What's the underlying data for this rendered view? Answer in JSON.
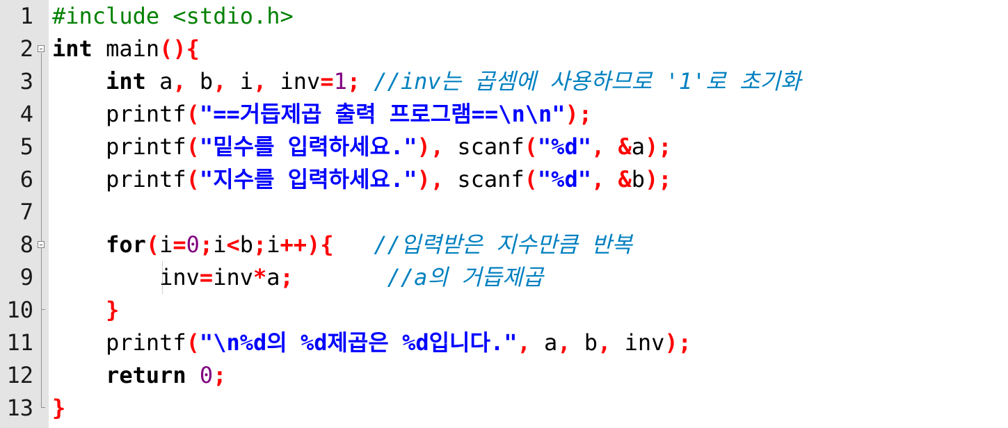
{
  "editor": {
    "line_numbers": [
      "1",
      "2",
      "3",
      "4",
      "5",
      "6",
      "7",
      "8",
      "9",
      "10",
      "11",
      "12",
      "13"
    ],
    "lines": [
      [
        {
          "t": "#include <stdio.h>",
          "c": "pp"
        }
      ],
      [
        {
          "t": "int",
          "c": "kw"
        },
        {
          "t": " main",
          "c": "id"
        },
        {
          "t": "(){",
          "c": "op"
        }
      ],
      [
        {
          "t": "    ",
          "c": "id"
        },
        {
          "t": "int",
          "c": "kw"
        },
        {
          "t": " a",
          "c": "id"
        },
        {
          "t": ",",
          "c": "op"
        },
        {
          "t": " b",
          "c": "id"
        },
        {
          "t": ",",
          "c": "op"
        },
        {
          "t": " i",
          "c": "id"
        },
        {
          "t": ",",
          "c": "op"
        },
        {
          "t": " inv",
          "c": "id"
        },
        {
          "t": "=",
          "c": "op"
        },
        {
          "t": "1",
          "c": "num"
        },
        {
          "t": ";",
          "c": "op"
        },
        {
          "t": " //inv는 곱셈에 사용하므로 '1'로 초기화",
          "c": "cm"
        }
      ],
      [
        {
          "t": "    printf",
          "c": "id"
        },
        {
          "t": "(",
          "c": "op"
        },
        {
          "t": "\"==거듭제곱 출력 프로그램==\\n\\n\"",
          "c": "str"
        },
        {
          "t": ");",
          "c": "op"
        }
      ],
      [
        {
          "t": "    printf",
          "c": "id"
        },
        {
          "t": "(",
          "c": "op"
        },
        {
          "t": "\"밑수를 입력하세요.\"",
          "c": "str"
        },
        {
          "t": "),",
          "c": "op"
        },
        {
          "t": " scanf",
          "c": "id"
        },
        {
          "t": "(",
          "c": "op"
        },
        {
          "t": "\"%d\"",
          "c": "str"
        },
        {
          "t": ",",
          "c": "op"
        },
        {
          "t": " ",
          "c": "id"
        },
        {
          "t": "&",
          "c": "op"
        },
        {
          "t": "a",
          "c": "id"
        },
        {
          "t": ");",
          "c": "op"
        }
      ],
      [
        {
          "t": "    printf",
          "c": "id"
        },
        {
          "t": "(",
          "c": "op"
        },
        {
          "t": "\"지수를 입력하세요.\"",
          "c": "str"
        },
        {
          "t": "),",
          "c": "op"
        },
        {
          "t": " scanf",
          "c": "id"
        },
        {
          "t": "(",
          "c": "op"
        },
        {
          "t": "\"%d\"",
          "c": "str"
        },
        {
          "t": ",",
          "c": "op"
        },
        {
          "t": " ",
          "c": "id"
        },
        {
          "t": "&",
          "c": "op"
        },
        {
          "t": "b",
          "c": "id"
        },
        {
          "t": ");",
          "c": "op"
        }
      ],
      [
        {
          "t": "",
          "c": "id"
        }
      ],
      [
        {
          "t": "    ",
          "c": "id"
        },
        {
          "t": "for",
          "c": "kw"
        },
        {
          "t": "(",
          "c": "op"
        },
        {
          "t": "i",
          "c": "id"
        },
        {
          "t": "=",
          "c": "op"
        },
        {
          "t": "0",
          "c": "num"
        },
        {
          "t": ";",
          "c": "op"
        },
        {
          "t": "i",
          "c": "id"
        },
        {
          "t": "<",
          "c": "op"
        },
        {
          "t": "b",
          "c": "id"
        },
        {
          "t": ";",
          "c": "op"
        },
        {
          "t": "i",
          "c": "id"
        },
        {
          "t": "++){",
          "c": "op"
        },
        {
          "t": "   //입력받은 지수만큼 반복",
          "c": "cm"
        }
      ],
      [
        {
          "t": "        inv",
          "c": "id"
        },
        {
          "t": "=",
          "c": "op"
        },
        {
          "t": "inv",
          "c": "id"
        },
        {
          "t": "*",
          "c": "op"
        },
        {
          "t": "a",
          "c": "id"
        },
        {
          "t": ";",
          "c": "op"
        },
        {
          "t": "       //a의 거듭제곱",
          "c": "cm"
        }
      ],
      [
        {
          "t": "    ",
          "c": "id"
        },
        {
          "t": "}",
          "c": "op"
        }
      ],
      [
        {
          "t": "    printf",
          "c": "id"
        },
        {
          "t": "(",
          "c": "op"
        },
        {
          "t": "\"\\n%d의 %d제곱은 %d입니다.\"",
          "c": "str"
        },
        {
          "t": ",",
          "c": "op"
        },
        {
          "t": " a",
          "c": "id"
        },
        {
          "t": ",",
          "c": "op"
        },
        {
          "t": " b",
          "c": "id"
        },
        {
          "t": ",",
          "c": "op"
        },
        {
          "t": " inv",
          "c": "id"
        },
        {
          "t": ");",
          "c": "op"
        }
      ],
      [
        {
          "t": "    ",
          "c": "id"
        },
        {
          "t": "return",
          "c": "kw"
        },
        {
          "t": " ",
          "c": "id"
        },
        {
          "t": "0",
          "c": "num"
        },
        {
          "t": ";",
          "c": "op"
        }
      ],
      [
        {
          "t": "}",
          "c": "op"
        }
      ]
    ],
    "fold_markers": [
      {
        "line": 2,
        "kind": "collapse"
      },
      {
        "line": 8,
        "kind": "collapse"
      }
    ],
    "colors": {
      "preprocessor": "#008000",
      "keyword": "#000000",
      "operator": "#ff0000",
      "number": "#800080",
      "string": "#0000ff",
      "comment": "#0080c0",
      "gutter_bg": "#e4e4e4"
    }
  }
}
